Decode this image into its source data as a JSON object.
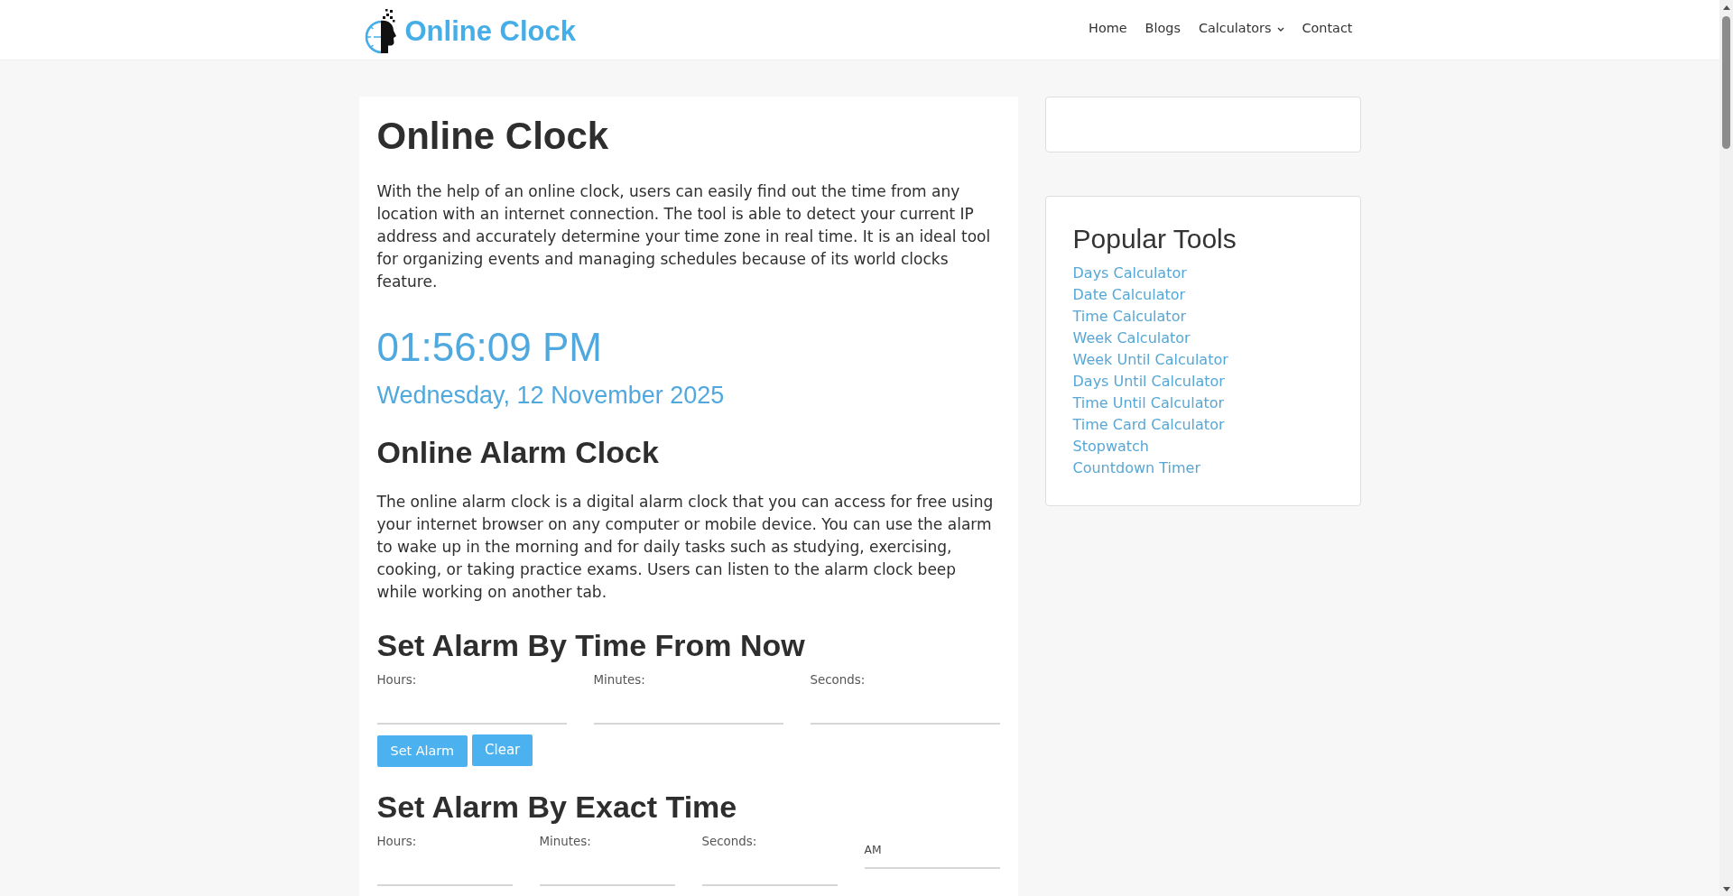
{
  "header": {
    "logo": "Online Clock",
    "nav": [
      {
        "label": "Home",
        "kind": "link"
      },
      {
        "label": "Blogs",
        "kind": "link"
      },
      {
        "label": "Calculators",
        "kind": "dropdown"
      },
      {
        "label": "Contact",
        "kind": "link"
      }
    ]
  },
  "main": {
    "title": "Online Clock",
    "intro": "With the help of an online clock, users can easily find out the time from any location with an internet connection. The tool is able to detect your current IP address and accurately determine your time zone in real time. It is an ideal tool for organizing events and managing schedules because of its world clocks feature.",
    "clock": {
      "time": "01:56:09 PM",
      "date": "Wednesday, 12 November 2025"
    },
    "alarm_heading": "Online Alarm Clock",
    "alarm_text": "The online alarm clock is a digital alarm clock that you can access for free using your internet browser on any computer or mobile device. You can use the alarm to wake up in the morning and for daily tasks such as studying, exercising, cooking, or taking practice exams. Users can listen to the alarm clock beep while working on another tab.",
    "from_now": {
      "heading": "Set Alarm By Time From Now",
      "fields": [
        {
          "label": "Hours:"
        },
        {
          "label": "Minutes:"
        },
        {
          "label": "Seconds:"
        }
      ],
      "buttons": [
        "Set Alarm",
        "Clear"
      ]
    },
    "exact": {
      "heading": "Set Alarm By Exact Time",
      "fields": [
        {
          "label": "Hours:"
        },
        {
          "label": "Minutes:"
        },
        {
          "label": "Seconds:"
        }
      ],
      "period": {
        "value": "AM"
      }
    }
  },
  "sidebar": {
    "popular_tools": {
      "title": "Popular Tools",
      "links": [
        "Days Calculator",
        "Date Calculator",
        "Time Calculator",
        "Week Calculator",
        "Week Until Calculator",
        "Days Until Calculator",
        "Time Until Calculator",
        "Time Card Calculator",
        "Stopwatch",
        "Countdown Timer"
      ]
    }
  }
}
